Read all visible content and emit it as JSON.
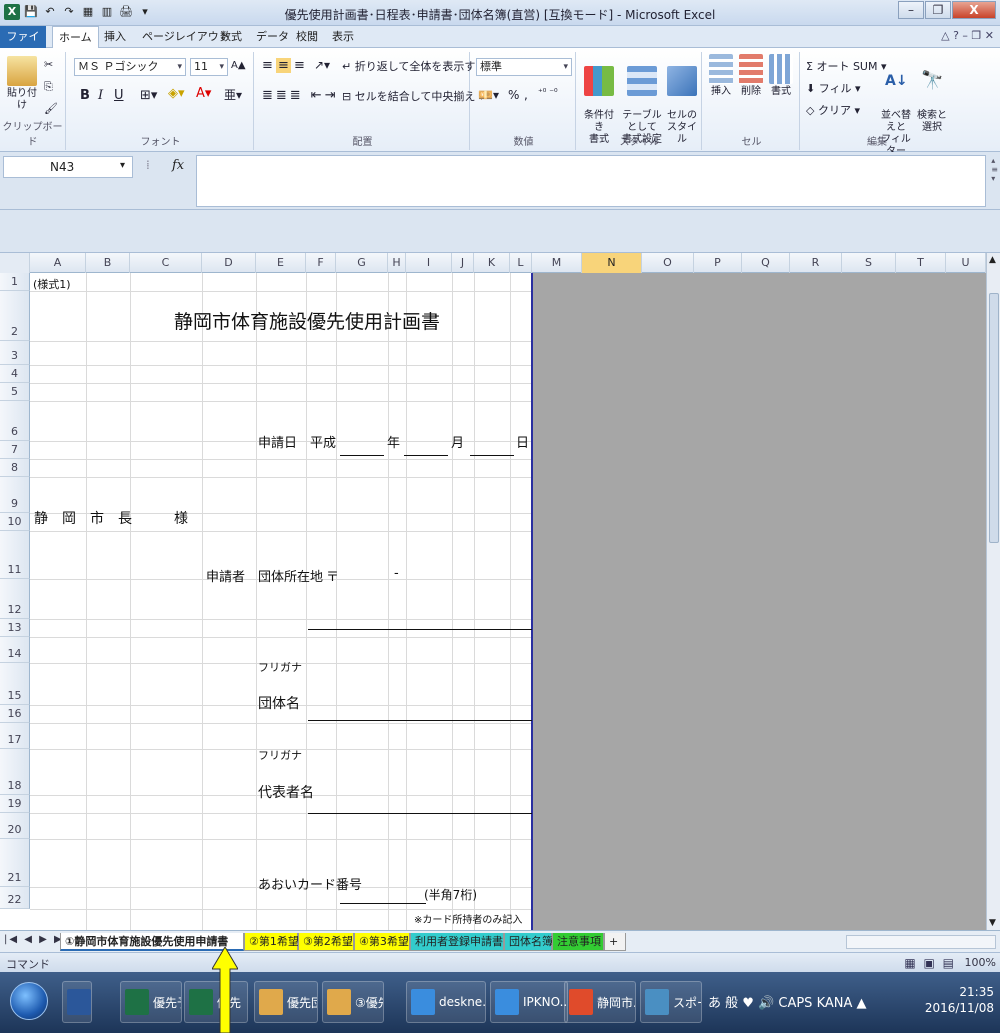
{
  "window": {
    "title": "優先使用計画書･日程表･申請書･団体名簿(直営)  [互換モード] - Microsoft Excel",
    "minimize": "–",
    "restore": "❐",
    "close": "X"
  },
  "ribbon_tabs": {
    "file": "ファイル",
    "home": "ホーム",
    "insert": "挿入",
    "page_layout": "ページレイアウト",
    "formulas": "数式",
    "data": "データ",
    "review": "校閲",
    "view": "表示",
    "help_glyphs": "△ ? – ❐ ✕"
  },
  "ribbon": {
    "clipboard": {
      "paste": "貼り付け",
      "label": "クリップボード"
    },
    "font": {
      "name": "ＭＳ Ｐゴシック",
      "size": "11",
      "grow": "A▲",
      "shrink": "A▼",
      "bold": "B",
      "italic": "I",
      "underline": "U",
      "label": "フォント"
    },
    "alignment": {
      "wrap": "折り返して全体を表示する",
      "merge": "セルを結合して中央揃え",
      "label": "配置"
    },
    "number": {
      "format": "標準",
      "percent": "%",
      "comma": ",",
      "label": "数値"
    },
    "styles": {
      "conditional": "条件付き\n書式",
      "table": "テーブルとして\n書式設定",
      "cell": "セルの\nスタイル",
      "label": "スタイル"
    },
    "cells": {
      "insert": "挿入",
      "delete": "削除",
      "format": "書式",
      "label": "セル"
    },
    "editing": {
      "autosum": "Σ オート SUM",
      "fill": "フィル",
      "clear": "クリア",
      "sort": "並べ替えと\nフィルター",
      "find": "検索と\n選択",
      "label": "編集"
    }
  },
  "formula_bar": {
    "name_box": "N43",
    "fx": "fx",
    "value": ""
  },
  "columns": [
    "A",
    "B",
    "C",
    "D",
    "E",
    "F",
    "G",
    "H",
    "I",
    "J",
    "K",
    "L",
    "M",
    "N",
    "O",
    "P",
    "Q",
    "R",
    "S",
    "T",
    "U"
  ],
  "selected_column": "N",
  "rows": [
    "1",
    "2",
    "3",
    "4",
    "5",
    "6",
    "7",
    "8",
    "9",
    "10",
    "11",
    "12",
    "13",
    "14",
    "15",
    "16",
    "17",
    "18",
    "19",
    "20",
    "21",
    "22"
  ],
  "sheet": {
    "form_no": "(様式1)",
    "title": "静岡市体育施設優先使用計画書",
    "date_label": "申請日",
    "era": "平成",
    "year": "年",
    "month": "月",
    "day": "日",
    "addressee": "静　岡　市　長　　　様",
    "applicant": "申請者",
    "address_label": "団体所在地",
    "postal_mark": "〒",
    "postal_dash": "-",
    "furigana1": "フリガナ",
    "group_name": "団体名",
    "furigana2": "フリガナ",
    "rep_name": "代表者名",
    "card_label": "あおいカード番号",
    "card_hint": "(半角7桁)",
    "card_note": "※カード所持者のみ記入"
  },
  "sheet_tabs": [
    {
      "label": "①静岡市体育施設優先使用申請書",
      "color": "#ffffff"
    },
    {
      "label": "②第1希望",
      "color": "#ffff00"
    },
    {
      "label": "③第2希望",
      "color": "#ffff00"
    },
    {
      "label": "④第3希望",
      "color": "#ffff00"
    },
    {
      "label": "利用者登録申請書",
      "color": "#33cccc"
    },
    {
      "label": "団体名簿",
      "color": "#33cccc"
    },
    {
      "label": "注意事項",
      "color": "#33cc33"
    }
  ],
  "sheet_nav": "|◀ ◀ ▶ ▶|",
  "status": {
    "mode": "コマンド",
    "zoom": "100%",
    "views": "▦ ▣ ▤"
  },
  "taskbar": {
    "items": [
      "優先予...",
      "優先",
      "優先団...",
      "③優先...",
      "deskne...",
      "IPKNO...",
      "静岡市...",
      "スポー..."
    ],
    "tray": "あ 般 ♥ 🔊 CAPS KANA ▲",
    "time": "21:35",
    "date": "2016/11/08"
  },
  "colors": {
    "accent_blue": "#2a6bb4",
    "excel_green": "#1e7145",
    "selected_col": "#f8d47a",
    "out_of_print": "#a6a6a6",
    "arrow": "#ffff00"
  }
}
